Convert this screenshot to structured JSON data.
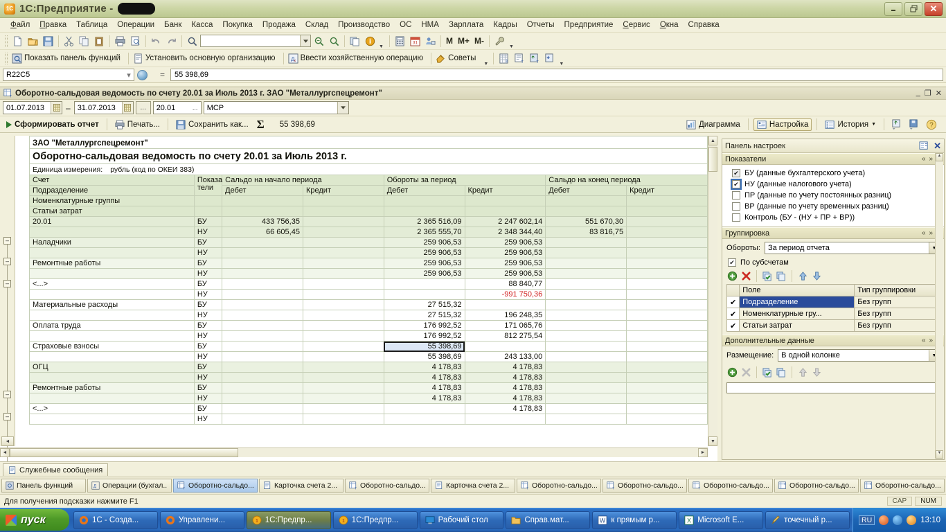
{
  "window": {
    "title": "1С:Предприятие -",
    "minimize": "–",
    "maximize": "❐",
    "close": "✕"
  },
  "menu": [
    "Файл",
    "Правка",
    "Таблица",
    "Операции",
    "Банк",
    "Касса",
    "Покупка",
    "Продажа",
    "Склад",
    "Производство",
    "ОС",
    "НМА",
    "Зарплата",
    "Кадры",
    "Отчеты",
    "Предприятие",
    "Сервис",
    "Окна",
    "Справка"
  ],
  "toolbar2": {
    "show_functions_panel": "Показать панель функций",
    "set_main_org": "Установить основную организацию",
    "enter_operation": "Ввести хозяйственную операцию",
    "advice": "Советы",
    "m_letters": [
      "M",
      "M+",
      "M-"
    ]
  },
  "formula_bar": {
    "cell_ref": "R22C5",
    "equals": "=",
    "value": "55 398,69"
  },
  "child_window": {
    "title": "Оборотно-сальдовая ведомость по счету 20.01 за Июль 2013 г.  ЗАО \"Металлургспецремонт\"",
    "minimize": "_",
    "restore": "❐",
    "close": "✕",
    "params": {
      "date_from": "01.07.2013",
      "date_to": "31.07.2013",
      "ellipsis": "...",
      "account": "20.01",
      "organization": "МСР"
    },
    "actions": {
      "generate": "Сформировать отчет",
      "print": "Печать...",
      "save_as": "Сохранить как...",
      "sum_symbol": "Σ",
      "sum_value": "55 398,69",
      "chart": "Диаграмма",
      "settings": "Настройка",
      "history": "История"
    }
  },
  "report": {
    "org": "ЗАО \"Металлургспецремонт\"",
    "title": "Оборотно-сальдовая ведомость по счету 20.01 за Июль 2013 г.",
    "unit_label": "Единица измерения:",
    "unit_value": "рубль (код по ОКЕИ 383)",
    "header": {
      "left_rows": [
        "Счет",
        "Подразделение",
        "Номенклатурные группы",
        "Статьи затрат"
      ],
      "indicators": "Показа\nтели",
      "indicators_l1": "Показа",
      "indicators_l2": "тели",
      "groups": [
        {
          "title": "Сальдо на начало периода",
          "cols": [
            "Дебет",
            "Кредит"
          ]
        },
        {
          "title": "Обороты за период",
          "cols": [
            "Дебет",
            "Кредит"
          ]
        },
        {
          "title": "Сальдо на конец периода",
          "cols": [
            "Дебет",
            "Кредит"
          ]
        }
      ]
    },
    "rows": [
      {
        "label": "20.01",
        "indent": 0,
        "shade": "grp0",
        "ind": "БУ",
        "start_d": "433 756,35",
        "start_c": "",
        "turn_d": "2 365 516,09",
        "turn_c": "2 247 602,14",
        "end_d": "551 670,30",
        "end_c": ""
      },
      {
        "label": "",
        "indent": 0,
        "shade": "grp0",
        "ind": "НУ",
        "start_d": "66 605,45",
        "start_c": "",
        "turn_d": "2 365 555,70",
        "turn_c": "2 348 344,40",
        "end_d": "83 816,75",
        "end_c": ""
      },
      {
        "label": "Наладчики",
        "indent": 1,
        "shade": "grp1",
        "ind": "БУ",
        "start_d": "",
        "start_c": "",
        "turn_d": "259 906,53",
        "turn_c": "259 906,53",
        "end_d": "",
        "end_c": ""
      },
      {
        "label": "",
        "indent": 1,
        "shade": "grp1",
        "ind": "НУ",
        "start_d": "",
        "start_c": "",
        "turn_d": "259 906,53",
        "turn_c": "259 906,53",
        "end_d": "",
        "end_c": ""
      },
      {
        "label": "Ремонтные работы",
        "indent": 2,
        "shade": "grp2",
        "ind": "БУ",
        "start_d": "",
        "start_c": "",
        "turn_d": "259 906,53",
        "turn_c": "259 906,53",
        "end_d": "",
        "end_c": ""
      },
      {
        "label": "",
        "indent": 2,
        "shade": "grp2",
        "ind": "НУ",
        "start_d": "",
        "start_c": "",
        "turn_d": "259 906,53",
        "turn_c": "259 906,53",
        "end_d": "",
        "end_c": ""
      },
      {
        "label": "<...>",
        "indent": 3,
        "shade": "grp3",
        "ind": "БУ",
        "start_d": "",
        "start_c": "",
        "turn_d": "",
        "turn_c": "88 840,77",
        "end_d": "",
        "end_c": ""
      },
      {
        "label": "",
        "indent": 3,
        "shade": "grp3",
        "ind": "НУ",
        "start_d": "",
        "start_c": "",
        "turn_d": "",
        "turn_c": "-991 750,36",
        "turn_c_neg": true,
        "end_d": "",
        "end_c": ""
      },
      {
        "label": "Материальные расходы",
        "indent": 3,
        "shade": "grp3",
        "ind": "БУ",
        "start_d": "",
        "start_c": "",
        "turn_d": "27 515,32",
        "turn_c": "",
        "end_d": "",
        "end_c": ""
      },
      {
        "label": "",
        "indent": 3,
        "shade": "grp3",
        "ind": "НУ",
        "start_d": "",
        "start_c": "",
        "turn_d": "27 515,32",
        "turn_c": "196 248,35",
        "end_d": "",
        "end_c": ""
      },
      {
        "label": "Оплата труда",
        "indent": 3,
        "shade": "grp3",
        "ind": "БУ",
        "start_d": "",
        "start_c": "",
        "turn_d": "176 992,52",
        "turn_c": "171 065,76",
        "end_d": "",
        "end_c": ""
      },
      {
        "label": "",
        "indent": 3,
        "shade": "grp3",
        "ind": "НУ",
        "start_d": "",
        "start_c": "",
        "turn_d": "176 992,52",
        "turn_c": "812 275,54",
        "end_d": "",
        "end_c": ""
      },
      {
        "label": "Страховые взносы",
        "indent": 3,
        "shade": "grp3",
        "ind": "БУ",
        "start_d": "",
        "start_c": "",
        "turn_d": "55 398,69",
        "turn_d_selected": true,
        "turn_c": "",
        "end_d": "",
        "end_c": ""
      },
      {
        "label": "",
        "indent": 3,
        "shade": "grp3",
        "ind": "НУ",
        "start_d": "",
        "start_c": "",
        "turn_d": "55 398,69",
        "turn_c": "243 133,00",
        "end_d": "",
        "end_c": ""
      },
      {
        "label": "ОГЦ",
        "indent": 1,
        "shade": "grp1",
        "ind": "БУ",
        "start_d": "",
        "start_c": "",
        "turn_d": "4 178,83",
        "turn_c": "4 178,83",
        "end_d": "",
        "end_c": ""
      },
      {
        "label": "",
        "indent": 1,
        "shade": "grp1",
        "ind": "НУ",
        "start_d": "",
        "start_c": "",
        "turn_d": "4 178,83",
        "turn_c": "4 178,83",
        "end_d": "",
        "end_c": ""
      },
      {
        "label": "Ремонтные работы",
        "indent": 2,
        "shade": "grp2",
        "ind": "БУ",
        "start_d": "",
        "start_c": "",
        "turn_d": "4 178,83",
        "turn_c": "4 178,83",
        "end_d": "",
        "end_c": ""
      },
      {
        "label": "",
        "indent": 2,
        "shade": "grp2",
        "ind": "НУ",
        "start_d": "",
        "start_c": "",
        "turn_d": "4 178,83",
        "turn_c": "4 178,83",
        "end_d": "",
        "end_c": ""
      },
      {
        "label": "<...>",
        "indent": 3,
        "shade": "grp3",
        "ind": "БУ",
        "start_d": "",
        "start_c": "",
        "turn_d": "",
        "turn_c": "4 178,83",
        "end_d": "",
        "end_c": ""
      },
      {
        "label": "",
        "indent": 3,
        "shade": "grp3",
        "ind": "НУ",
        "start_d": "",
        "start_c": "",
        "turn_d": "",
        "turn_c": "",
        "end_d": "",
        "end_c": ""
      }
    ]
  },
  "settings_panel": {
    "title": "Панель настроек",
    "close": "✕",
    "sections": {
      "indicators": {
        "title": "Показатели",
        "items": [
          {
            "label": "БУ (данные бухгалтерского учета)",
            "checked": true,
            "focused": false,
            "dim": true
          },
          {
            "label": "НУ (данные налогового учета)",
            "checked": true,
            "focused": true,
            "dim": false
          },
          {
            "label": "ПР (данные по учету постоянных разниц)",
            "checked": false,
            "focused": false,
            "dim": false
          },
          {
            "label": "ВР (данные по учету временных разниц)",
            "checked": false,
            "focused": false,
            "dim": false
          },
          {
            "label": "Контроль (БУ - (НУ + ПР + ВР))",
            "checked": false,
            "focused": false,
            "dim": false
          }
        ]
      },
      "grouping": {
        "title": "Группировка",
        "turnover_label": "Обороты:",
        "turnover_value": "За период отчета",
        "subaccounts_label": "По субсчетам",
        "subaccounts_checked": true,
        "columns": [
          "Поле",
          "Тип группировки"
        ],
        "rows": [
          {
            "checked": true,
            "field": "Подразделение",
            "type": "Без групп",
            "selected": true
          },
          {
            "checked": true,
            "field": "Номенклатурные гру...",
            "type": "Без групп",
            "selected": false
          },
          {
            "checked": true,
            "field": "Статьи затрат",
            "type": "Без групп",
            "selected": false
          }
        ]
      },
      "additional": {
        "title": "Дополнительные данные",
        "placement_label": "Размещение:",
        "placement_value": "В одной колонке"
      }
    },
    "collapse_controls": {
      "prev": "«",
      "next": "»",
      "menu": "▼"
    }
  },
  "service_messages_tab": "Служебные сообщения",
  "window_tabs": [
    {
      "label": "Панель функций",
      "icon": "panel-icon",
      "active": false
    },
    {
      "label": "Операции (бухгал...",
      "icon": "ops-icon",
      "active": false
    },
    {
      "label": "Оборотно-сальдо...",
      "icon": "report-icon",
      "active": true
    },
    {
      "label": "Карточка счета 2...",
      "icon": "card-icon",
      "active": false
    },
    {
      "label": "Оборотно-сальдо...",
      "icon": "report-icon",
      "active": false
    },
    {
      "label": "Карточка счета 2...",
      "icon": "card-icon",
      "active": false
    },
    {
      "label": "Оборотно-сальдо...",
      "icon": "report-icon",
      "active": false
    },
    {
      "label": "Оборотно-сальдо...",
      "icon": "report-icon",
      "active": false
    },
    {
      "label": "Оборотно-сальдо...",
      "icon": "report-icon",
      "active": false
    },
    {
      "label": "Оборотно-сальдо...",
      "icon": "sum-icon",
      "active": false
    },
    {
      "label": "Оборотно-сальдо...",
      "icon": "sum-icon",
      "active": false
    }
  ],
  "statusbar": {
    "hint": "Для получения подсказки нажмите F1",
    "caps": "CAP",
    "num": "NUM"
  },
  "taskbar": {
    "start": "пуск",
    "items": [
      {
        "label": "1С - Созда...",
        "icon": "firefox-icon",
        "active": false
      },
      {
        "label": "Управлени...",
        "icon": "firefox-icon",
        "active": false
      },
      {
        "label": "1С:Предпр...",
        "icon": "1c-icon",
        "active": true
      },
      {
        "label": "1С:Предпр...",
        "icon": "1c-icon",
        "active": false
      },
      {
        "label": "Рабочий стол",
        "icon": "desktop-icon",
        "active": false
      },
      {
        "label": "Справ.мат...",
        "icon": "folder-icon",
        "active": false
      },
      {
        "label": "к прямым р...",
        "icon": "word-icon",
        "active": false
      },
      {
        "label": "Microsoft E...",
        "icon": "excel-icon",
        "active": false
      },
      {
        "label": "точечный р...",
        "icon": "paint-icon",
        "active": false
      }
    ],
    "lang": "RU",
    "clock": "13:10"
  },
  "colors": {
    "accent_green": "#dde8cd",
    "title_gradient_start": "#dfe4c2",
    "selection_blue": "#2a4b9b",
    "negative_red": "#d01f1f",
    "taskbar_blue": "#2b6fc4"
  }
}
